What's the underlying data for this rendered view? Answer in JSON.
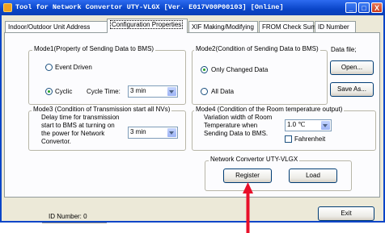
{
  "title_bar": {
    "title": "Tool for Network Convertor UTY-VLGX [Ver. E017V00P00103] [Online]",
    "min_glyph": "_",
    "max_glyph": "□",
    "close_glyph": "X"
  },
  "tabs": [
    {
      "label": "Indoor/Outdoor Unit Address"
    },
    {
      "label": "Configuration Properties"
    },
    {
      "label": "XIF Making/Modifying"
    },
    {
      "label": "FROM Check Sum"
    },
    {
      "label": "ID Number"
    }
  ],
  "mode1": {
    "title": "Mode1(Property of Sending Data to BMS)",
    "option_event": "Event Driven",
    "option_cyclic": "Cyclic",
    "cycle_time_label": "Cycle Time:",
    "cycle_time_value": "3 min"
  },
  "mode2": {
    "title": "Mode2(Condition of Sending Data to BMS)",
    "option_changed": "Only Changed Data",
    "option_all": "All Data"
  },
  "data_file": {
    "title": "Data file;",
    "open_label": "Open...",
    "save_label": "Save As..."
  },
  "mode3": {
    "title": "Mode3 (Condition of Transmission start all NVs)",
    "line1": "Delay time for transmission",
    "line2": "start to BMS at turning on",
    "line3": "the power for Network",
    "line4": "Convertor.",
    "delay_value": "3 min"
  },
  "mode4": {
    "title": "Mode4 (Condition of the Room temperature output)",
    "line1": "Variation width of Room",
    "line2": "Temperature when",
    "line3": "Sending Data to BMS.",
    "width_value": "1.0 ℃",
    "fahrenheit_label": "Fahrenheit"
  },
  "network_convertor": {
    "title": "Network Convertor UTY-VLGX",
    "register_label": "Register",
    "load_label": "Load"
  },
  "footer": {
    "id_number": "ID Number:  0",
    "exit_label": "Exit"
  },
  "colors": {
    "titlebar": "#0a45c8",
    "window_bg": "#ece9d8",
    "panel_bg": "#fcfcfe",
    "radio_dot": "#21a121",
    "annotation_arrow": "#e8102a"
  }
}
